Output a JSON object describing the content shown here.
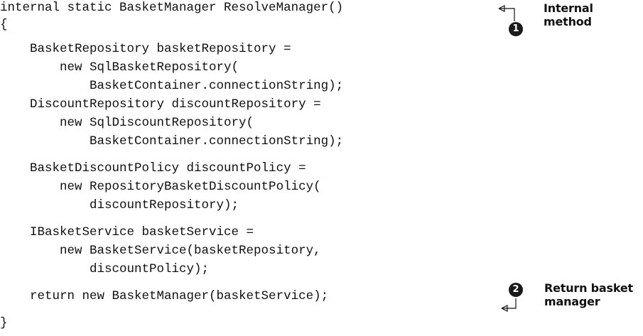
{
  "code_lines": [
    "internal static BasketManager ResolveManager()",
    "{",
    "    BasketRepository basketRepository =",
    "        new SqlBasketRepository(",
    "            BasketContainer.connectionString);",
    "    DiscountRepository discountRepository =",
    "        new SqlDiscountRepository(",
    "            BasketContainer.connectionString);",
    "    BasketDiscountPolicy discountPolicy =",
    "        new RepositoryBasketDiscountPolicy(",
    "            discountRepository);",
    "    IBasketService basketService =",
    "        new BasketService(basketRepository,",
    "            discountPolicy);",
    "    return new BasketManager(basketService);",
    "}"
  ],
  "annotations": [
    {
      "number": "1",
      "label": "Internal\nmethod"
    },
    {
      "number": "2",
      "label": "Return basket\nmanager"
    }
  ]
}
